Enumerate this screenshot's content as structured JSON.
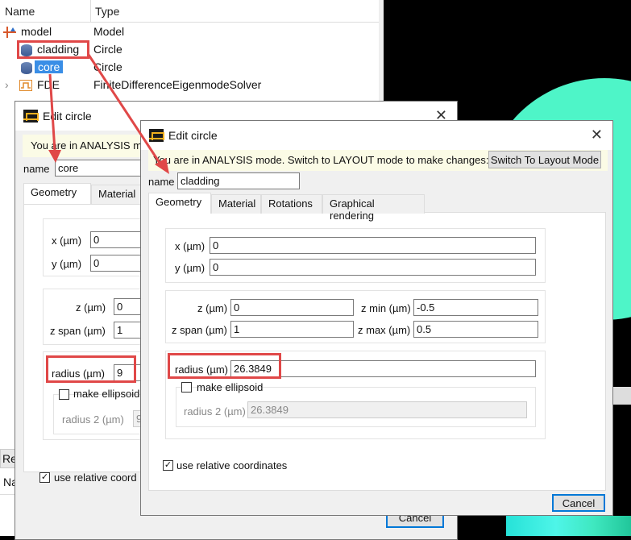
{
  "tree": {
    "columns": [
      "Name",
      "Type"
    ],
    "rows": [
      {
        "name": "model",
        "type": "Model",
        "icon": "model-icon"
      },
      {
        "name": "cladding",
        "type": "Circle",
        "icon": "circle-object-icon"
      },
      {
        "name": "core",
        "type": "Circle",
        "icon": "circle-object-icon",
        "selected": true
      },
      {
        "name": "FDE",
        "type": "FiniteDifferenceEigenmodeSolver",
        "icon": "solver-icon",
        "expandable": true
      }
    ]
  },
  "back_panel": {
    "tab_label_partial": "Re",
    "col_label_partial": "Na"
  },
  "dialog_core": {
    "title": "Edit circle",
    "banner": "You are in ANALYSIS m",
    "name_label": "name",
    "name_value": "core",
    "tabs": [
      "Geometry",
      "Material"
    ],
    "x_label": "x (µm)",
    "x_value": "0",
    "y_label": "y (µm)",
    "y_value": "0",
    "z_label": "z (µm)",
    "z_value": "0",
    "zspan_label": "z span (µm)",
    "zspan_value": "1",
    "radius_label": "radius (µm)",
    "radius_value": "9",
    "ellipsoid_label": "make ellipsoid",
    "radius2_label": "radius 2 (µm)",
    "radius2_value": "9",
    "relative_label": "use relative coord",
    "cancel_label": "Cancel"
  },
  "dialog_cladding": {
    "title": "Edit circle",
    "close_glyph": "✕",
    "banner": "You are in ANALYSIS mode.  Switch to LAYOUT mode to make changes:",
    "switch_button": "Switch To Layout Mode",
    "name_label": "name",
    "name_value": "cladding",
    "tabs": [
      "Geometry",
      "Material",
      "Rotations",
      "Graphical rendering"
    ],
    "x_label": "x (µm)",
    "x_value": "0",
    "y_label": "y (µm)",
    "y_value": "0",
    "z_label": "z (µm)",
    "z_value": "0",
    "zspan_label": "z span (µm)",
    "zspan_value": "1",
    "zmin_label": "z min (µm)",
    "zmin_value": "-0.5",
    "zmax_label": "z max (µm)",
    "zmax_value": "0.5",
    "radius_label": "radius (µm)",
    "radius_value": "26.3849",
    "ellipsoid_label": "make ellipsoid",
    "ellipsoid_checked": false,
    "radius2_label": "radius 2 (µm)",
    "radius2_value": "26.3849",
    "relative_label": "use relative coordinates",
    "relative_checked": true,
    "cancel_label": "Cancel"
  },
  "colors": {
    "highlight_red": "#e04848",
    "selection_blue": "#3a8ee6",
    "teal_shape": "#4ef5c8",
    "banner_bg": "#fbfbe6",
    "logo_gold": "#f2b01e"
  }
}
